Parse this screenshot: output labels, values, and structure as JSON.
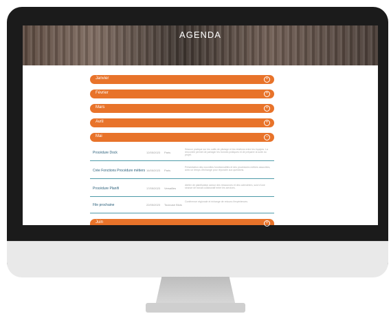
{
  "hero": {
    "title": "AGENDA"
  },
  "months": [
    {
      "label": "Janvier",
      "icon": "+"
    },
    {
      "label": "Février",
      "icon": "+"
    },
    {
      "label": "Mars",
      "icon": "+"
    },
    {
      "label": "Avril",
      "icon": "+"
    },
    {
      "label": "Mai",
      "icon": "−"
    }
  ],
  "events": [
    {
      "name": "Procédure Dock",
      "date": "12/05/2023",
      "place": "Paris",
      "desc": "Séance pratique sur les outils de pilotage et les relations entre les équipes. La rencontre permet de partager les bonnes pratiques et de préparer la suite du projet."
    },
    {
      "name": "Crée Fonctions Procédure métiers",
      "date": "16/05/2023",
      "place": "Paris",
      "desc": "Présentation des nouvelles fonctionnalités et des procédures métiers associées, avec un temps d'échange pour répondre aux questions."
    },
    {
      "name": "Procédure Planifi",
      "date": "17/05/2023",
      "place": "Versailles",
      "desc": "Atelier de planification autour des ressources et des calendriers, suivi d'une séance de travail collaboratif entre les services."
    },
    {
      "name": "File prochaine",
      "date": "22/05/2023",
      "place": "Toulouse Blois",
      "desc": "Conférence régionale et échange de retours d'expériences."
    }
  ],
  "next_month": {
    "label": "Juin",
    "icon": "+"
  }
}
